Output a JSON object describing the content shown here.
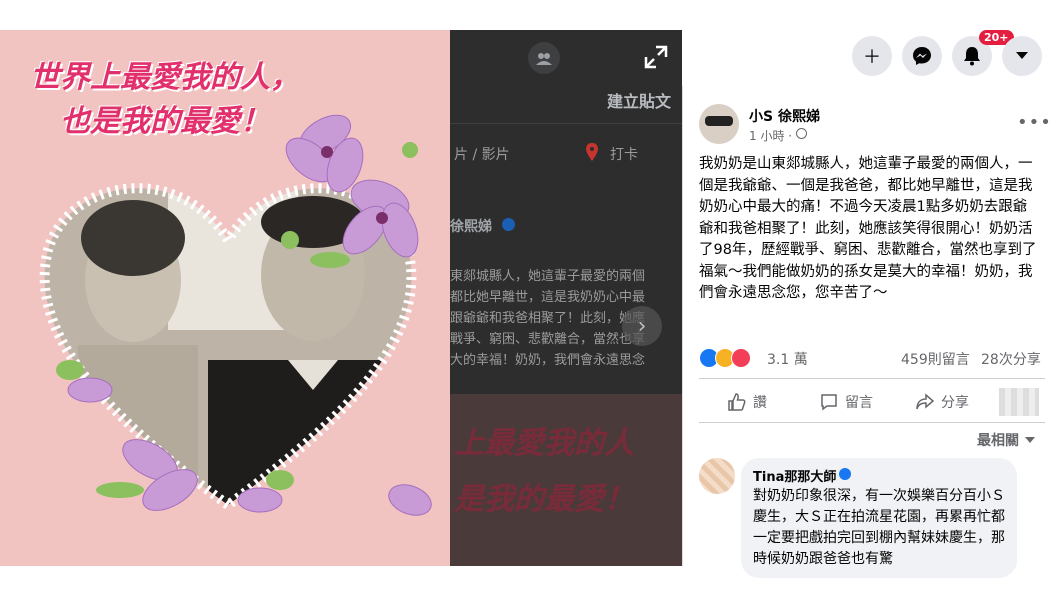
{
  "photo": {
    "title_line1": "世界上最愛我的人，",
    "title_line2": "也是我的最愛！"
  },
  "dimmed": {
    "create_post": "建立貼文",
    "tab_photo": "片 / 影片",
    "tab_checkin": "打卡",
    "author_partial": "徐熙娣",
    "text_lines": [
      "東郯城縣人，她這輩子最愛的兩個",
      "都比她早離世，這是我奶奶心中最",
      "跟爺爺和我爸相聚了！此刻，她應",
      "戰爭、窮困、悲歡離合，當然也享",
      "大的幸福！奶奶，我們會永遠思念"
    ],
    "big_line1": "上最愛我的人",
    "big_line2": "是我的最愛！"
  },
  "topbar": {
    "notif_count": "20+"
  },
  "post": {
    "author": "小S 徐熙娣",
    "time": "1 小時 ·",
    "body": "我奶奶是山東郯城縣人，她這輩子最愛的兩個人，一個是我爺爺、一個是我爸爸，都比她早離世，這是我奶奶心中最大的痛！不過今天凌晨1點多奶奶去跟爺爺和我爸相聚了！此刻，她應該笑得很開心！奶奶活了98年，歷經戰爭、窮困、悲歡離合，當然也享到了福氣～我們能做奶奶的孫女是莫大的幸福！奶奶，我們會永遠思念您，您辛苦了～",
    "reactions_count": "3.1 萬",
    "comments_count": "459則留言",
    "shares_count": "28次分享",
    "like_label": "讚",
    "comment_label": "留言",
    "share_label": "分享",
    "sort_label": "最相關",
    "comment": {
      "author": "Tina那那大師",
      "text": "對奶奶印象很深，有一次娛樂百分百小Ｓ慶生，大Ｓ正在拍流星花園，再累再忙都一定要把戲拍完回到棚內幫妹妹慶生，那時候奶奶跟爸爸也有驚"
    }
  },
  "colors": {
    "photo_bg": "#f1c3c1",
    "title_pink": "#e2306c",
    "fb_blue": "#1877f2",
    "badge_red": "#e41e3f"
  }
}
